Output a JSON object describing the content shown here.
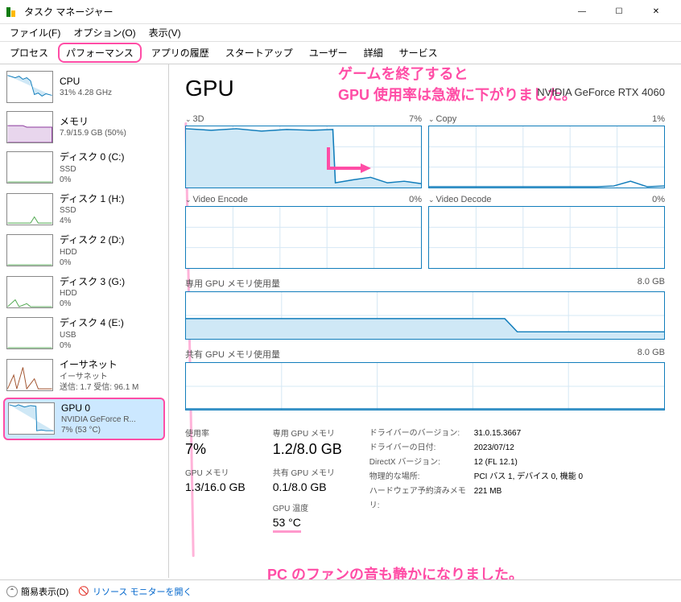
{
  "window": {
    "title": "タスク マネージャー",
    "minimize": "—",
    "maximize": "☐",
    "close": "✕"
  },
  "menu": {
    "file": "ファイル(F)",
    "options": "オプション(O)",
    "view": "表示(V)"
  },
  "tabs": {
    "processes": "プロセス",
    "performance": "パフォーマンス",
    "app_history": "アプリの履歴",
    "startup": "スタートアップ",
    "users": "ユーザー",
    "details": "詳細",
    "services": "サービス"
  },
  "sidebar": {
    "cpu": {
      "name": "CPU",
      "sub": "31%  4.28 GHz"
    },
    "memory": {
      "name": "メモリ",
      "sub": "7.9/15.9 GB (50%)"
    },
    "disk0": {
      "name": "ディスク 0 (C:)",
      "type": "SSD",
      "pct": "0%"
    },
    "disk1": {
      "name": "ディスク 1 (H:)",
      "type": "SSD",
      "pct": "4%"
    },
    "disk2": {
      "name": "ディスク 2 (D:)",
      "type": "HDD",
      "pct": "0%"
    },
    "disk3": {
      "name": "ディスク 3 (G:)",
      "type": "HDD",
      "pct": "0%"
    },
    "disk4": {
      "name": "ディスク 4 (E:)",
      "type": "USB",
      "pct": "0%"
    },
    "ethernet": {
      "name": "イーサネット",
      "sub1": "イーサネット",
      "sub2": "送信: 1.7 受信: 96.1 M"
    },
    "gpu0": {
      "name": "GPU 0",
      "sub1": "NVIDIA GeForce R...",
      "sub2": "7% (53 °C)"
    }
  },
  "gpu": {
    "title": "GPU",
    "device": "NVIDIA GeForce RTX 4060",
    "charts": {
      "threeD": {
        "label": "3D",
        "pct": "7%"
      },
      "copy": {
        "label": "Copy",
        "pct": "1%"
      },
      "encode": {
        "label": "Video Encode",
        "pct": "0%"
      },
      "decode": {
        "label": "Video Decode",
        "pct": "0%"
      },
      "dedicated": {
        "label": "専用 GPU メモリ使用量",
        "max": "8.0 GB"
      },
      "shared": {
        "label": "共有 GPU メモリ使用量",
        "max": "8.0 GB"
      }
    },
    "stats": {
      "usage": {
        "label": "使用率",
        "value": "7%"
      },
      "gpu_mem": {
        "label": "GPU メモリ",
        "value": "1.3/16.0 GB"
      },
      "dedicated": {
        "label": "専用 GPU メモリ",
        "value": "1.2/8.0 GB"
      },
      "shared": {
        "label": "共有 GPU メモリ",
        "value": "0.1/8.0 GB"
      },
      "temp": {
        "label": "GPU 温度",
        "value": "53 °C"
      }
    },
    "meta": {
      "driver_version": {
        "k": "ドライバーのバージョン:",
        "v": "31.0.15.3667"
      },
      "driver_date": {
        "k": "ドライバーの日付:",
        "v": "2023/07/12"
      },
      "directx": {
        "k": "DirectX バージョン:",
        "v": "12 (FL 12.1)"
      },
      "location": {
        "k": "物理的な場所:",
        "v": "PCI バス 1, デバイス 0, 機能 0"
      },
      "reserved": {
        "k": "ハードウェア予約済みメモリ:",
        "v": "221 MB"
      }
    }
  },
  "annotations": {
    "line1": "ゲームを終了すると",
    "line2": "GPU 使用率は急激に下がりました。",
    "line3": "PC のファンの音も静かになりました。"
  },
  "footer": {
    "simple": "簡易表示(D)",
    "resource_monitor": "リソース モニターを開く"
  },
  "chart_data": {
    "type": "line",
    "charts": [
      {
        "name": "3D",
        "ylim": [
          0,
          100
        ],
        "values": [
          98,
          95,
          97,
          94,
          96,
          95,
          97,
          93,
          96,
          95,
          8,
          10,
          7,
          15,
          8,
          6
        ]
      },
      {
        "name": "Copy",
        "ylim": [
          0,
          100
        ],
        "values": [
          0,
          0,
          0,
          0,
          0,
          0,
          0,
          0,
          0,
          0,
          0,
          0,
          1,
          0,
          3,
          1
        ]
      },
      {
        "name": "Video Encode",
        "ylim": [
          0,
          100
        ],
        "values": [
          0,
          0,
          0,
          0,
          0,
          0,
          0,
          0,
          0,
          0,
          0,
          0,
          0,
          0,
          0,
          0
        ]
      },
      {
        "name": "Video Decode",
        "ylim": [
          0,
          100
        ],
        "values": [
          0,
          0,
          0,
          0,
          0,
          0,
          0,
          0,
          0,
          0,
          0,
          0,
          0,
          0,
          0,
          0
        ]
      },
      {
        "name": "Dedicated GPU Memory",
        "ylim": [
          0,
          8.0
        ],
        "values": [
          3.4,
          3.4,
          3.4,
          3.4,
          3.4,
          3.4,
          3.4,
          3.4,
          3.4,
          3.4,
          3.4,
          1.2,
          1.2,
          1.2,
          1.2,
          1.2
        ]
      },
      {
        "name": "Shared GPU Memory",
        "ylim": [
          0,
          8.0
        ],
        "values": [
          0.1,
          0.1,
          0.1,
          0.1,
          0.1,
          0.1,
          0.1,
          0.1,
          0.1,
          0.1,
          0.1,
          0.1,
          0.1,
          0.1,
          0.1,
          0.1
        ]
      }
    ]
  }
}
